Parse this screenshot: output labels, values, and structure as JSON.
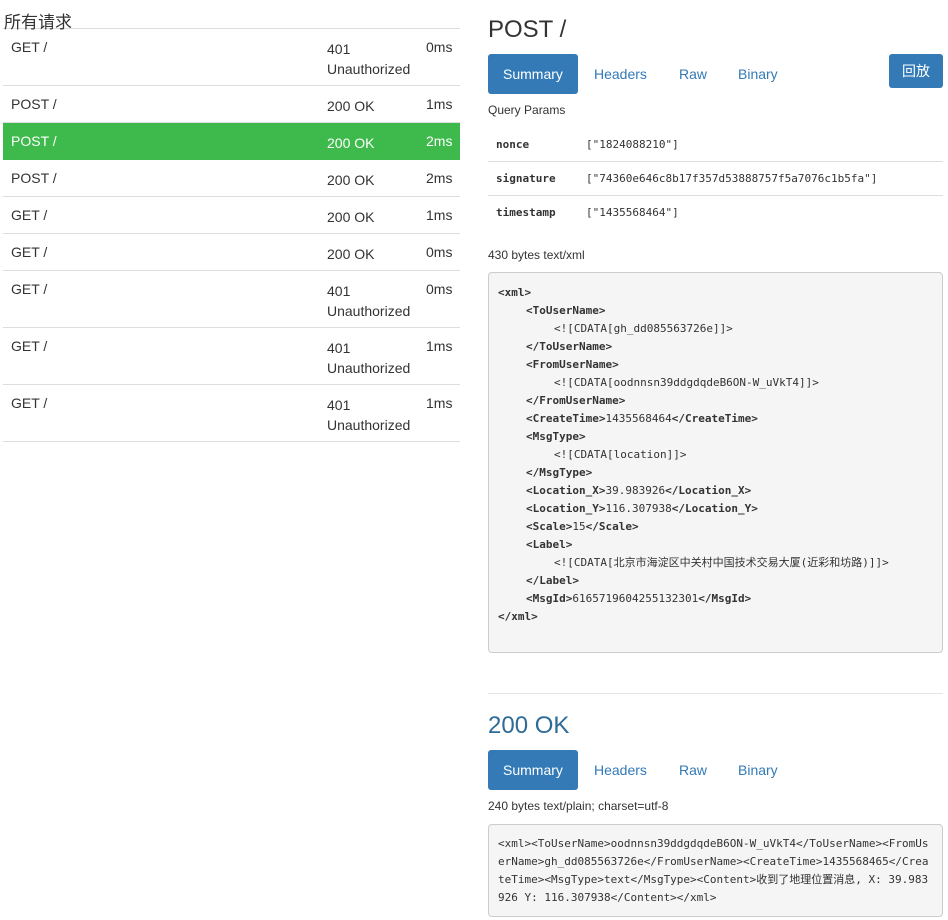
{
  "left": {
    "title": "所有请求",
    "requests": [
      {
        "method": "GET /",
        "status": "401 Unauthorized",
        "time": "0ms"
      },
      {
        "method": "POST /",
        "status": "200 OK",
        "time": "1ms"
      },
      {
        "method": "POST /",
        "status": "200 OK",
        "time": "2ms"
      },
      {
        "method": "POST /",
        "status": "200 OK",
        "time": "2ms"
      },
      {
        "method": "GET /",
        "status": "200 OK",
        "time": "1ms"
      },
      {
        "method": "GET /",
        "status": "200 OK",
        "time": "0ms"
      },
      {
        "method": "GET /",
        "status": "401 Unauthorized",
        "time": "0ms"
      },
      {
        "method": "GET /",
        "status": "401 Unauthorized",
        "time": "1ms"
      },
      {
        "method": "GET /",
        "status": "401 Unauthorized",
        "time": "1ms"
      }
    ]
  },
  "request": {
    "title": "POST /",
    "tabs": [
      "Summary",
      "Headers",
      "Raw",
      "Binary"
    ],
    "replay_label": "回放",
    "query_params_label": "Query Params",
    "params": [
      {
        "key": "nonce",
        "value": "[\"1824088210\"]"
      },
      {
        "key": "signature",
        "value": "[\"74360e646c8b17f357d53888757f5a7076c1b5fa\"]"
      },
      {
        "key": "timestamp",
        "value": "[\"1435568464\"]"
      }
    ],
    "body_info": "430 bytes text/xml",
    "xml_lines": [
      {
        "indent": 0,
        "parts": [
          [
            "tag",
            "<xml>"
          ]
        ]
      },
      {
        "indent": 1,
        "parts": [
          [
            "tag",
            "<ToUserName>"
          ]
        ]
      },
      {
        "indent": 2,
        "parts": [
          [
            "text",
            "<![CDATA[gh_dd085563726e]]>"
          ]
        ]
      },
      {
        "indent": 1,
        "parts": [
          [
            "tag",
            "</ToUserName>"
          ]
        ]
      },
      {
        "indent": 1,
        "parts": [
          [
            "tag",
            "<FromUserName>"
          ]
        ]
      },
      {
        "indent": 2,
        "parts": [
          [
            "text",
            "<![CDATA[oodnnsn39ddgdqdeB6ON-W_uVkT4]]>"
          ]
        ]
      },
      {
        "indent": 1,
        "parts": [
          [
            "tag",
            "</FromUserName>"
          ]
        ]
      },
      {
        "indent": 1,
        "parts": [
          [
            "tag",
            "<CreateTime>"
          ],
          [
            "text",
            "1435568464"
          ],
          [
            "tag",
            "</CreateTime>"
          ]
        ]
      },
      {
        "indent": 1,
        "parts": [
          [
            "tag",
            "<MsgType>"
          ]
        ]
      },
      {
        "indent": 2,
        "parts": [
          [
            "text",
            "<![CDATA[location]]>"
          ]
        ]
      },
      {
        "indent": 1,
        "parts": [
          [
            "tag",
            "</MsgType>"
          ]
        ]
      },
      {
        "indent": 1,
        "parts": [
          [
            "tag",
            "<Location_X>"
          ],
          [
            "text",
            "39.983926"
          ],
          [
            "tag",
            "</Location_X>"
          ]
        ]
      },
      {
        "indent": 1,
        "parts": [
          [
            "tag",
            "<Location_Y>"
          ],
          [
            "text",
            "116.307938"
          ],
          [
            "tag",
            "</Location_Y>"
          ]
        ]
      },
      {
        "indent": 1,
        "parts": [
          [
            "tag",
            "<Scale>"
          ],
          [
            "text",
            "15"
          ],
          [
            "tag",
            "</Scale>"
          ]
        ]
      },
      {
        "indent": 1,
        "parts": [
          [
            "tag",
            "<Label>"
          ]
        ]
      },
      {
        "indent": 2,
        "parts": [
          [
            "text",
            "<![CDATA[北京市海淀区中关村中国技术交易大厦(近彩和坊路)]]>"
          ]
        ]
      },
      {
        "indent": 1,
        "parts": [
          [
            "tag",
            "</Label>"
          ]
        ]
      },
      {
        "indent": 1,
        "parts": [
          [
            "tag",
            "<MsgId>"
          ],
          [
            "text",
            "6165719604255132301"
          ],
          [
            "tag",
            "</MsgId>"
          ]
        ]
      },
      {
        "indent": 0,
        "parts": [
          [
            "tag",
            "</xml>"
          ]
        ]
      }
    ]
  },
  "response": {
    "title": "200 OK",
    "tabs": [
      "Summary",
      "Headers",
      "Raw",
      "Binary"
    ],
    "body_info": "240 bytes text/plain; charset=utf-8",
    "body": "<xml><ToUserName>oodnnsn39ddgdqdeB6ON-W_uVkT4</ToUserName><FromUserName>gh_dd085563726e</FromUserName><CreateTime>1435568465</CreateTime><MsgType>text</MsgType><Content>收到了地理位置消息, X: 39.983926 Y: 116.307938</Content></xml>"
  },
  "colors": {
    "accent": "#337ab7",
    "active_row": "#3eb94b"
  }
}
